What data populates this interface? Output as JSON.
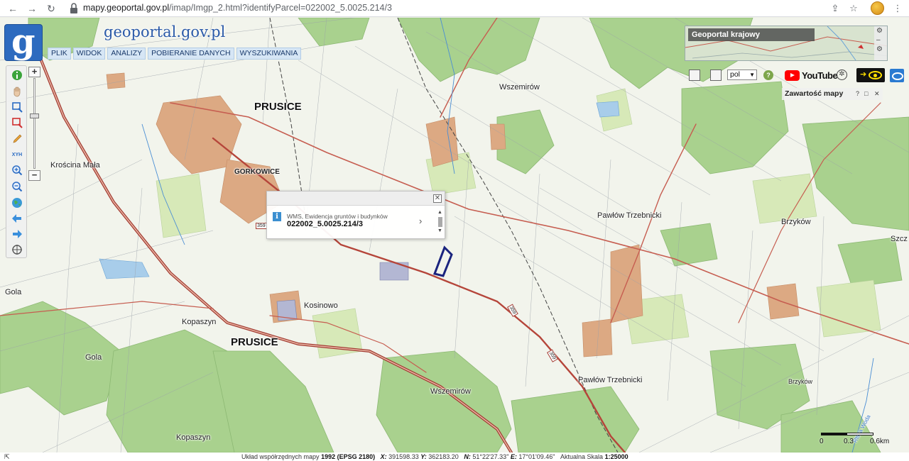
{
  "browser": {
    "url_host": "mapy.geoportal.gov.pl",
    "url_path": "/imap/Imgp_2.html?identifyParcel=022002_5.0025.214/3"
  },
  "logo": {
    "letter": "g",
    "text": "geoportal.gov.pl"
  },
  "menu": [
    "PLIK",
    "WIDOK",
    "ANALIZY",
    "POBIERANIE DANYCH",
    "WYSZUKIWANIA"
  ],
  "toolbar_icons": [
    "info-icon",
    "pan-hand-icon",
    "zoom-box-icon",
    "zoom-out-box-icon",
    "pencil-icon",
    "xyz-coordinates-icon",
    "zoom-in-icon",
    "zoom-out-icon",
    "globe-icon",
    "back-arrow-icon",
    "forward-arrow-icon",
    "crosshair-icon"
  ],
  "toolbar": {
    "xyz_label": "XYH"
  },
  "zoom": {
    "plus": "+",
    "minus": "−"
  },
  "popup": {
    "source": "WMS, Ewidencja gruntów i budynków",
    "parcel_id": "022002_5.0025.214/3",
    "info_glyph": "i",
    "close_glyph": "✕",
    "arrow_glyph": "›"
  },
  "overview": {
    "title": "Geoportal krajowy"
  },
  "right_bar": {
    "language": "pol",
    "help": "?",
    "youtube": "YouTube",
    "wcag": "✲"
  },
  "map_contents": {
    "title": "Zawartość mapy",
    "help": "?",
    "restore": "□",
    "close": "✕"
  },
  "map_labels": {
    "prusice_top": "PRUSICE",
    "prusice_bottom": "PRUSICE",
    "gorkowice": "GORKOWICE",
    "kroscina": "Krościna Mała",
    "wszemirow_top": "Wszemirów",
    "wszemirow_bottom": "Wszemirów",
    "pawlow_top": "Pawłów Trzebnicki",
    "pawlow_bottom": "Pawłów Trzebnicki",
    "brzykow_top": "Brzyków",
    "brzykow_bottom": "Brzyków",
    "szcz": "Szcz",
    "gola_left": "Gola",
    "gola_mid": "Gola",
    "kopaszyn_top": "Kopaszyn",
    "kopaszyn_bottom": "Kopaszyn",
    "kosinowo": "Kosinowo",
    "road_359": "359",
    "road_359b": "359",
    "road_359c": "359",
    "river": "Rlska Woda"
  },
  "scale": {
    "zero": "0",
    "mid": "0.3",
    "end": "0.6km"
  },
  "status": {
    "crs_label": "Układ współrzędnych mapy",
    "crs_value": "1992 (EPSG 2180)",
    "x_label": "X:",
    "x_value": "391598.33",
    "y_label": "Y:",
    "y_value": "362183.20",
    "n_label": "N:",
    "n_value": "51°22'27.33\"",
    "e_label": "E:",
    "e_value": "17°01'09.46\"",
    "scale_label": "Aktualna Skala",
    "scale_value": "1:25000"
  },
  "colors": {
    "forest": "#a8d08d",
    "road_main": "#b5453a",
    "water": "#9fc8ea",
    "built": "#d9a882",
    "parcel": "#1a237e"
  }
}
